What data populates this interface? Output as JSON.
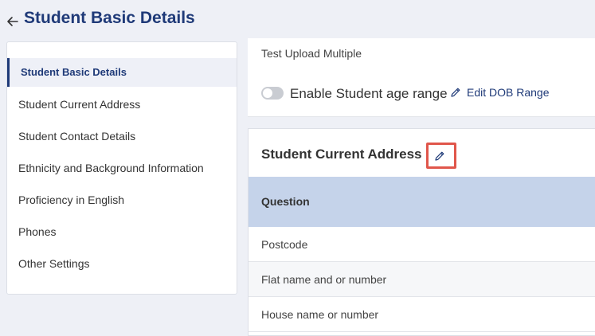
{
  "header": {
    "title": "Student Basic Details"
  },
  "sidebar": {
    "items": [
      {
        "label": "Student Basic Details",
        "active": true
      },
      {
        "label": "Student Current Address"
      },
      {
        "label": "Student Contact Details"
      },
      {
        "label": "Ethnicity and Background Information"
      },
      {
        "label": "Proficiency in English"
      },
      {
        "label": "Phones"
      },
      {
        "label": "Other Settings"
      }
    ]
  },
  "top_panel": {
    "upload_text": "Test Upload Multiple",
    "toggle_label": "Enable Student age range",
    "toggle_on": false,
    "edit_dob_label": "Edit DOB Range"
  },
  "section": {
    "title": "Student Current Address",
    "table_header": "Question",
    "rows": [
      "Postcode",
      "Flat name and or number",
      "House name or number"
    ]
  },
  "colors": {
    "accent": "#1f3a78",
    "highlight_box": "#e0564b",
    "table_header_bg": "#c5d3ea"
  }
}
